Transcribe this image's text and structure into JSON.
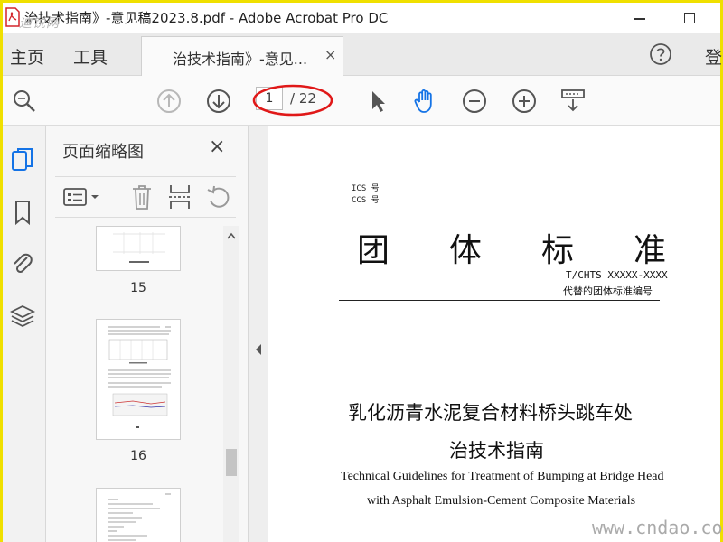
{
  "window": {
    "title": "治技术指南》-意见稿2023.8.pdf - Adobe Acrobat Pro DC",
    "watermark_top": "迪锐网"
  },
  "menu": {
    "home": "主页",
    "tools": "工具",
    "sign_in": "登"
  },
  "tab": {
    "label": "治技术指南》-意见...",
    "close": "×"
  },
  "toolbar": {
    "page_current": "1",
    "page_total": "/ 22"
  },
  "thumbnails_panel": {
    "title": "页面缩略图",
    "close": "×",
    "pages": [
      {
        "label": "15"
      },
      {
        "label": "16"
      }
    ]
  },
  "document": {
    "ics": "ICS 号",
    "ccs": "CCS 号",
    "heading": "团体标准",
    "code": "T/CHTS XXXXX-XXXX",
    "replace_note": "代替的团体标准编号",
    "title_cn_line1": "乳化沥青水泥复合材料桥头跳车处",
    "title_cn_line2": "治技术指南",
    "title_en_line1": "Technical Guidelines for Treatment of Bumping at Bridge Head",
    "title_en_line2": "with Asphalt Emulsion-Cement Composite Materials"
  },
  "watermark_bottom": "www.cndao.com",
  "colors": {
    "accent_blue": "#1473e6",
    "pdf_red": "#d4252b",
    "annotation_red": "#e01818",
    "frame_yellow": "#f0e000"
  },
  "icons": [
    "pdf-file-icon",
    "search-icon",
    "prev-page-icon",
    "next-page-icon",
    "select-cursor-icon",
    "hand-tool-icon",
    "zoom-out-icon",
    "zoom-in-icon",
    "scroll-mode-icon",
    "page-thumbnails-icon",
    "bookmark-icon",
    "attachment-icon",
    "layers-icon",
    "thumbnail-options-icon",
    "delete-icon",
    "extract-icon",
    "rotate-icon",
    "help-icon",
    "collapse-panel-icon"
  ]
}
